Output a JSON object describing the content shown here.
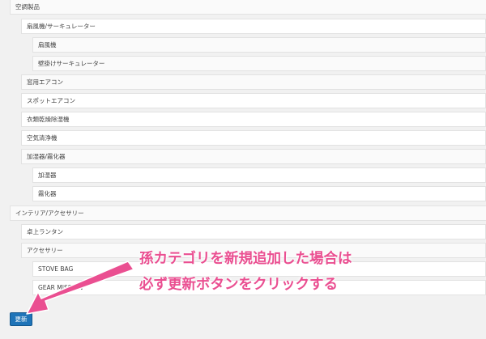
{
  "categories": [
    {
      "label": "空調製品"
    },
    {
      "label": "扇風機/サーキュレーター"
    },
    {
      "label": "扇風機"
    },
    {
      "label": "壁掛けサーキュレーター"
    },
    {
      "label": "窓用エアコン"
    },
    {
      "label": "スポットエアコン"
    },
    {
      "label": "衣類乾燥除湿機"
    },
    {
      "label": "空気清浄機"
    },
    {
      "label": "加湿器/霧化器"
    },
    {
      "label": "加湿器"
    },
    {
      "label": "霧化器"
    },
    {
      "label": "インテリア/アクセサリー"
    },
    {
      "label": "卓上ランタン"
    },
    {
      "label": "アクセサリー"
    },
    {
      "label": "STOVE BAG"
    },
    {
      "label": "GEAR MISSION"
    }
  ],
  "button": {
    "update_label": "更新"
  },
  "annotation": {
    "line1": "孫カテゴリを新規追加した場合は",
    "line2": "必ず更新ボタンをクリックする",
    "color": "#ea4f91"
  }
}
